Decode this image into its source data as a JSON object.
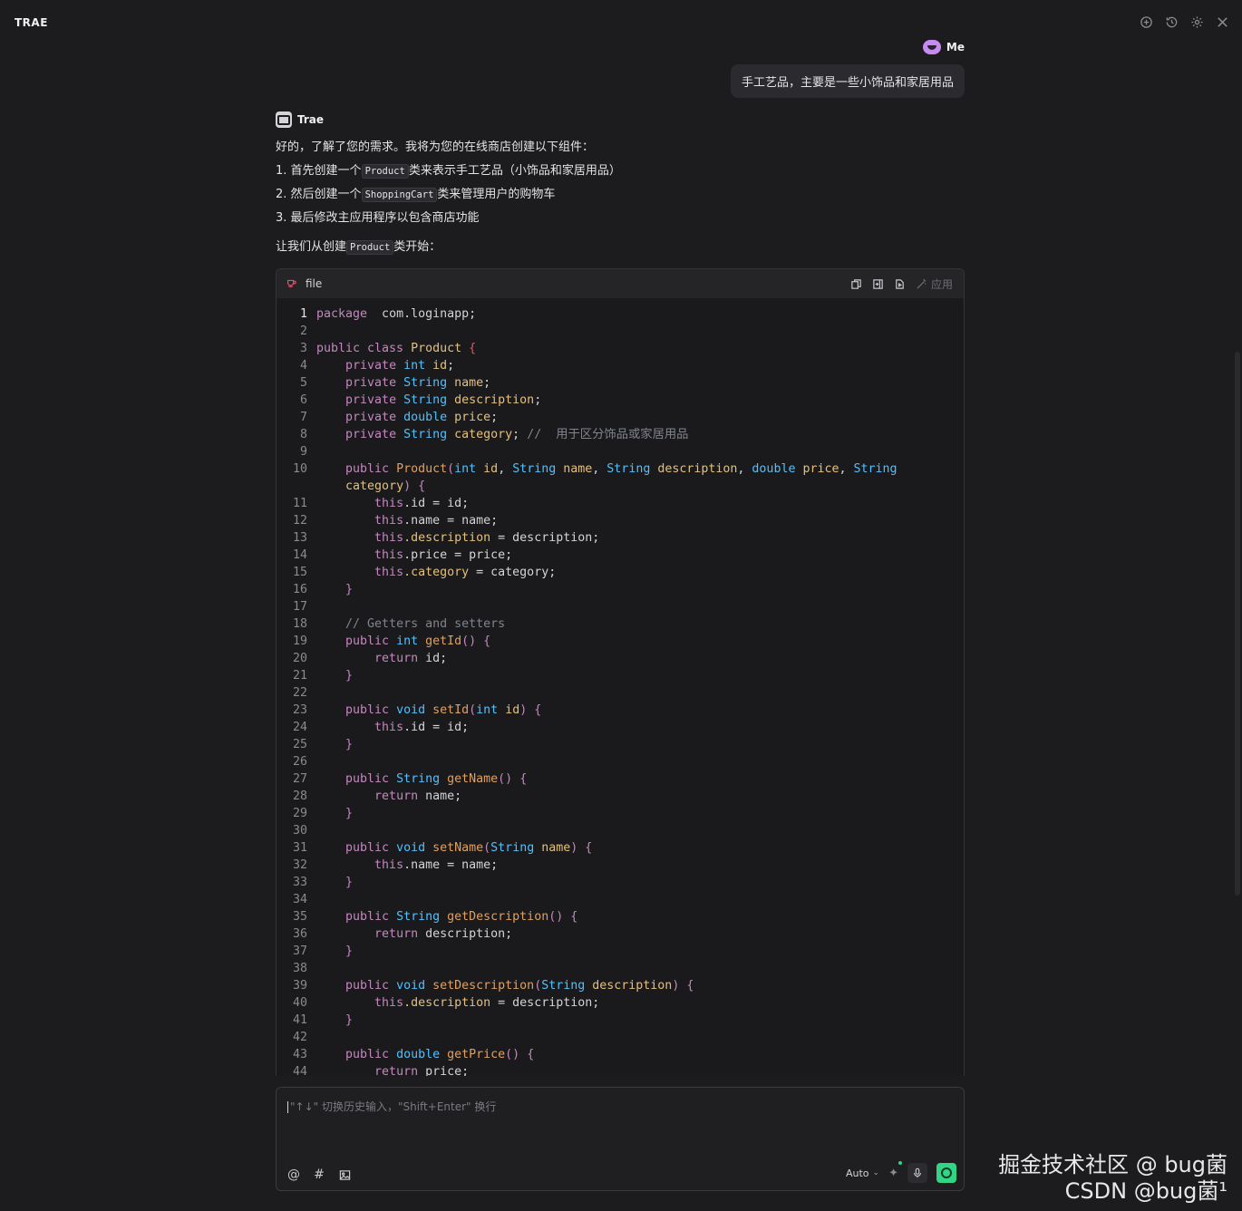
{
  "app": {
    "brand": "TRAE"
  },
  "header_icons": [
    "new-chat-icon",
    "history-icon",
    "settings-icon",
    "close-icon"
  ],
  "user": {
    "name": "Me",
    "message": "手工艺品，主要是一些小饰品和家居用品"
  },
  "assistant": {
    "name": "Trae",
    "intro": "好的，了解了您的需求。我将为您的在线商店创建以下组件：",
    "steps": [
      {
        "num": "1.",
        "pre": "首先创建一个",
        "code": "Product",
        "post": "类来表示手工艺品（小饰品和家居用品）"
      },
      {
        "num": "2.",
        "pre": "然后创建一个",
        "code": "ShoppingCart",
        "post": "类来管理用户的购物车"
      },
      {
        "num": "3.",
        "pre": "最后修改主应用程序以包含商店功能",
        "code": "",
        "post": ""
      }
    ],
    "lead": {
      "pre": "让我们从创建",
      "code": "Product",
      "post": "类开始："
    }
  },
  "code_block": {
    "filename": "file",
    "apply_label": "应用",
    "lines": [
      {
        "n": "1",
        "t": [
          [
            "kw",
            "package"
          ],
          [
            "",
            "  com.loginapp;"
          ]
        ]
      },
      {
        "n": "2",
        "t": []
      },
      {
        "n": "3",
        "t": [
          [
            "kw",
            "public class "
          ],
          [
            "cls",
            "Product"
          ],
          [
            "br",
            " {"
          ]
        ]
      },
      {
        "n": "4",
        "t": [
          [
            "",
            "    "
          ],
          [
            "kw",
            "private "
          ],
          [
            "ty",
            "int "
          ],
          [
            "fld",
            "id"
          ],
          [
            "",
            ";"
          ]
        ]
      },
      {
        "n": "5",
        "t": [
          [
            "",
            "    "
          ],
          [
            "kw",
            "private "
          ],
          [
            "ty",
            "String "
          ],
          [
            "fld",
            "name"
          ],
          [
            "",
            ";"
          ]
        ]
      },
      {
        "n": "6",
        "t": [
          [
            "",
            "    "
          ],
          [
            "kw",
            "private "
          ],
          [
            "ty",
            "String "
          ],
          [
            "fld",
            "description"
          ],
          [
            "",
            ";"
          ]
        ]
      },
      {
        "n": "7",
        "t": [
          [
            "",
            "    "
          ],
          [
            "kw",
            "private "
          ],
          [
            "ty",
            "double "
          ],
          [
            "fld",
            "price"
          ],
          [
            "",
            ";"
          ]
        ]
      },
      {
        "n": "8",
        "t": [
          [
            "",
            "    "
          ],
          [
            "kw",
            "private "
          ],
          [
            "ty",
            "String "
          ],
          [
            "fld",
            "category"
          ],
          [
            "",
            "; "
          ],
          [
            "cm",
            "//  用于区分饰品或家居用品"
          ]
        ]
      },
      {
        "n": "9",
        "t": []
      },
      {
        "n": "10",
        "t": [
          [
            "",
            "    "
          ],
          [
            "kw",
            "public "
          ],
          [
            "fn",
            "Product"
          ],
          [
            "kw",
            "("
          ],
          [
            "ty",
            "int "
          ],
          [
            "fld",
            "id"
          ],
          [
            "",
            ", "
          ],
          [
            "ty",
            "String "
          ],
          [
            "fld",
            "name"
          ],
          [
            "",
            ", "
          ],
          [
            "ty",
            "String "
          ],
          [
            "fld",
            "description"
          ],
          [
            "",
            ", "
          ],
          [
            "ty",
            "double "
          ],
          [
            "fld",
            "price"
          ],
          [
            "",
            ", "
          ],
          [
            "ty",
            "String"
          ]
        ]
      },
      {
        "n": "",
        "t": [
          [
            "",
            "    "
          ],
          [
            "fld",
            "category"
          ],
          [
            "kw",
            ") {"
          ]
        ]
      },
      {
        "n": "11",
        "t": [
          [
            "",
            "        "
          ],
          [
            "kw",
            "this"
          ],
          [
            "",
            ".id = id;"
          ]
        ]
      },
      {
        "n": "12",
        "t": [
          [
            "",
            "        "
          ],
          [
            "kw",
            "this"
          ],
          [
            "",
            ".name = name;"
          ]
        ]
      },
      {
        "n": "13",
        "t": [
          [
            "",
            "        "
          ],
          [
            "kw",
            "this"
          ],
          [
            "fld",
            ".description"
          ],
          [
            "",
            " = description;"
          ]
        ]
      },
      {
        "n": "14",
        "t": [
          [
            "",
            "        "
          ],
          [
            "kw",
            "this"
          ],
          [
            "",
            ".price = price;"
          ]
        ]
      },
      {
        "n": "15",
        "t": [
          [
            "",
            "        "
          ],
          [
            "kw",
            "this"
          ],
          [
            "fld",
            ".category"
          ],
          [
            "",
            " = category;"
          ]
        ]
      },
      {
        "n": "16",
        "t": [
          [
            "",
            "    "
          ],
          [
            "kw",
            "}"
          ]
        ]
      },
      {
        "n": "17",
        "t": []
      },
      {
        "n": "18",
        "t": [
          [
            "",
            "    "
          ],
          [
            "cm",
            "// Getters and setters"
          ]
        ]
      },
      {
        "n": "19",
        "t": [
          [
            "",
            "    "
          ],
          [
            "kw",
            "public "
          ],
          [
            "ty",
            "int "
          ],
          [
            "fn",
            "getId"
          ],
          [
            "kw",
            "() {"
          ]
        ]
      },
      {
        "n": "20",
        "t": [
          [
            "",
            "        "
          ],
          [
            "kw",
            "return "
          ],
          [
            "",
            "id;"
          ]
        ]
      },
      {
        "n": "21",
        "t": [
          [
            "",
            "    "
          ],
          [
            "kw",
            "}"
          ]
        ]
      },
      {
        "n": "22",
        "t": []
      },
      {
        "n": "23",
        "t": [
          [
            "",
            "    "
          ],
          [
            "kw",
            "public "
          ],
          [
            "ty",
            "void "
          ],
          [
            "fn",
            "setId"
          ],
          [
            "kw",
            "("
          ],
          [
            "ty",
            "int "
          ],
          [
            "fld",
            "id"
          ],
          [
            "kw",
            ") {"
          ]
        ]
      },
      {
        "n": "24",
        "t": [
          [
            "",
            "        "
          ],
          [
            "kw",
            "this"
          ],
          [
            "",
            ".id = id;"
          ]
        ]
      },
      {
        "n": "25",
        "t": [
          [
            "",
            "    "
          ],
          [
            "kw",
            "}"
          ]
        ]
      },
      {
        "n": "26",
        "t": []
      },
      {
        "n": "27",
        "t": [
          [
            "",
            "    "
          ],
          [
            "kw",
            "public "
          ],
          [
            "ty",
            "String "
          ],
          [
            "fn",
            "getName"
          ],
          [
            "kw",
            "() {"
          ]
        ]
      },
      {
        "n": "28",
        "t": [
          [
            "",
            "        "
          ],
          [
            "kw",
            "return "
          ],
          [
            "",
            "name;"
          ]
        ]
      },
      {
        "n": "29",
        "t": [
          [
            "",
            "    "
          ],
          [
            "kw",
            "}"
          ]
        ]
      },
      {
        "n": "30",
        "t": []
      },
      {
        "n": "31",
        "t": [
          [
            "",
            "    "
          ],
          [
            "kw",
            "public "
          ],
          [
            "ty",
            "void "
          ],
          [
            "fn",
            "setName"
          ],
          [
            "kw",
            "("
          ],
          [
            "ty",
            "String "
          ],
          [
            "fld",
            "name"
          ],
          [
            "kw",
            ") {"
          ]
        ]
      },
      {
        "n": "32",
        "t": [
          [
            "",
            "        "
          ],
          [
            "kw",
            "this"
          ],
          [
            "",
            ".name = name;"
          ]
        ]
      },
      {
        "n": "33",
        "t": [
          [
            "",
            "    "
          ],
          [
            "kw",
            "}"
          ]
        ]
      },
      {
        "n": "34",
        "t": []
      },
      {
        "n": "35",
        "t": [
          [
            "",
            "    "
          ],
          [
            "kw",
            "public "
          ],
          [
            "ty",
            "String "
          ],
          [
            "fn",
            "getDescription"
          ],
          [
            "kw",
            "() {"
          ]
        ]
      },
      {
        "n": "36",
        "t": [
          [
            "",
            "        "
          ],
          [
            "kw",
            "return "
          ],
          [
            "",
            "description;"
          ]
        ]
      },
      {
        "n": "37",
        "t": [
          [
            "",
            "    "
          ],
          [
            "kw",
            "}"
          ]
        ]
      },
      {
        "n": "38",
        "t": []
      },
      {
        "n": "39",
        "t": [
          [
            "",
            "    "
          ],
          [
            "kw",
            "public "
          ],
          [
            "ty",
            "void "
          ],
          [
            "fn",
            "setDescription"
          ],
          [
            "kw",
            "("
          ],
          [
            "ty",
            "String "
          ],
          [
            "fld",
            "description"
          ],
          [
            "kw",
            ") {"
          ]
        ]
      },
      {
        "n": "40",
        "t": [
          [
            "",
            "        "
          ],
          [
            "kw",
            "this"
          ],
          [
            "fld",
            ".description"
          ],
          [
            "",
            " = description;"
          ]
        ]
      },
      {
        "n": "41",
        "t": [
          [
            "",
            "    "
          ],
          [
            "kw",
            "}"
          ]
        ]
      },
      {
        "n": "42",
        "t": []
      },
      {
        "n": "43",
        "t": [
          [
            "",
            "    "
          ],
          [
            "kw",
            "public "
          ],
          [
            "ty",
            "double "
          ],
          [
            "fn",
            "getPrice"
          ],
          [
            "kw",
            "() {"
          ]
        ]
      },
      {
        "n": "44",
        "t": [
          [
            "",
            "        "
          ],
          [
            "kw",
            "return "
          ],
          [
            "",
            "price;"
          ]
        ]
      }
    ]
  },
  "input": {
    "placeholder": "\"↑↓\" 切换历史输入，\"Shift+Enter\" 换行",
    "model": "Auto"
  },
  "watermark": {
    "line1": "掘金技术社区 @ bug菌",
    "line2": "CSDN @bug菌¹"
  },
  "colors": {
    "background": "#1c1c1e",
    "accent": "#32d583",
    "keyword": "#c586c0",
    "type": "#4fc1ff"
  }
}
